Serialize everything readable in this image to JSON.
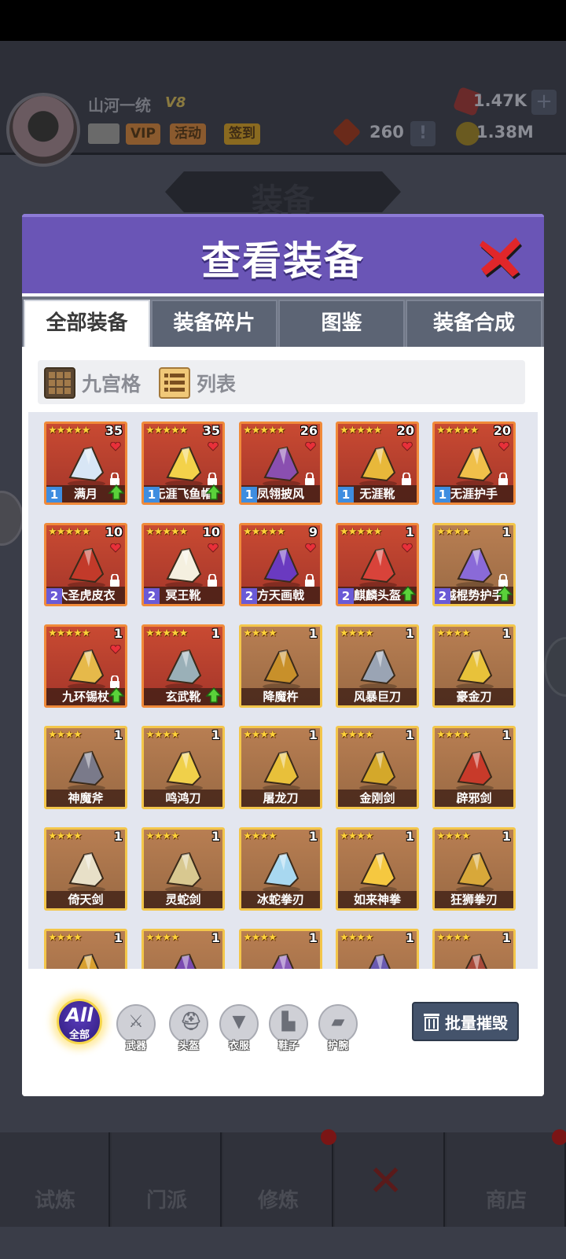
{
  "player": {
    "name": "山河一统",
    "vip_level": "V8",
    "chips": [
      "VIP",
      "活动",
      "签到"
    ],
    "gems": "1.47K",
    "tokens": "260",
    "gold": "1.38M"
  },
  "background_title": "装备",
  "bottom_nav": [
    "试炼",
    "门派",
    "修炼",
    "",
    "商店"
  ],
  "modal": {
    "title": "查看装备",
    "tabs": [
      "全部装备",
      "装备碎片",
      "图鉴",
      "装备合成"
    ],
    "active_tab": 0,
    "view_options": [
      "九宫格",
      "列表"
    ],
    "items": [
      {
        "name": "满月",
        "stars": 5,
        "count": "35",
        "level": "1",
        "rarity": "red",
        "heart": true,
        "lock": true,
        "upgrade": true,
        "icon": "moon-armor-icon"
      },
      {
        "name": "无涯飞鱼帽",
        "stars": 5,
        "count": "35",
        "level": "1",
        "rarity": "red",
        "heart": true,
        "lock": true,
        "upgrade": true,
        "icon": "gold-helmet-icon"
      },
      {
        "name": "凤翎披风",
        "stars": 5,
        "count": "26",
        "level": "1",
        "rarity": "red",
        "heart": true,
        "lock": true,
        "upgrade": false,
        "icon": "cloak-icon"
      },
      {
        "name": "无涯靴",
        "stars": 5,
        "count": "20",
        "level": "1",
        "rarity": "red",
        "heart": true,
        "lock": true,
        "upgrade": false,
        "icon": "boot-icon"
      },
      {
        "name": "无涯护手",
        "stars": 5,
        "count": "20",
        "level": "1",
        "rarity": "red",
        "heart": true,
        "lock": true,
        "upgrade": false,
        "icon": "bracer-icon"
      },
      {
        "name": "大圣虎皮衣",
        "stars": 5,
        "count": "10",
        "level": "2",
        "rarity": "red",
        "heart": true,
        "lock": true,
        "upgrade": false,
        "icon": "tiger-armor-icon"
      },
      {
        "name": "冥王靴",
        "stars": 5,
        "count": "10",
        "level": "2",
        "rarity": "red",
        "heart": true,
        "lock": true,
        "upgrade": false,
        "icon": "white-boot-icon"
      },
      {
        "name": "方天画戟",
        "stars": 5,
        "count": "9",
        "level": "2",
        "rarity": "red",
        "heart": true,
        "lock": true,
        "upgrade": false,
        "icon": "halberd-icon"
      },
      {
        "name": "麒麟头盔",
        "stars": 5,
        "count": "1",
        "level": "2",
        "rarity": "red",
        "heart": true,
        "lock": false,
        "upgrade": true,
        "icon": "qilin-helmet-icon"
      },
      {
        "name": "越棍势护手",
        "stars": 4,
        "count": "1",
        "level": "2",
        "rarity": "gold",
        "heart": false,
        "lock": true,
        "upgrade": true,
        "icon": "purple-bracer-icon"
      },
      {
        "name": "九环锡杖",
        "stars": 5,
        "count": "1",
        "level": "",
        "rarity": "red",
        "heart": true,
        "lock": true,
        "upgrade": true,
        "icon": "staff-icon"
      },
      {
        "name": "玄武靴",
        "stars": 5,
        "count": "1",
        "level": "",
        "rarity": "red",
        "heart": false,
        "lock": false,
        "upgrade": true,
        "icon": "xuanwu-boot-icon"
      },
      {
        "name": "降魔杵",
        "stars": 4,
        "count": "1",
        "level": "",
        "rarity": "gold",
        "heart": false,
        "lock": false,
        "upgrade": false,
        "icon": "pestle-icon"
      },
      {
        "name": "风暴巨刀",
        "stars": 4,
        "count": "1",
        "level": "",
        "rarity": "gold",
        "heart": false,
        "lock": false,
        "upgrade": false,
        "icon": "great-blade-icon"
      },
      {
        "name": "豪金刀",
        "stars": 4,
        "count": "1",
        "level": "",
        "rarity": "gold",
        "heart": false,
        "lock": false,
        "upgrade": false,
        "icon": "gold-blade-icon"
      },
      {
        "name": "神魔斧",
        "stars": 4,
        "count": "1",
        "level": "",
        "rarity": "gold",
        "heart": false,
        "lock": false,
        "upgrade": false,
        "icon": "axe-icon"
      },
      {
        "name": "鸣鸿刀",
        "stars": 4,
        "count": "1",
        "level": "",
        "rarity": "gold",
        "heart": false,
        "lock": false,
        "upgrade": false,
        "icon": "saber-icon"
      },
      {
        "name": "屠龙刀",
        "stars": 4,
        "count": "1",
        "level": "",
        "rarity": "gold",
        "heart": false,
        "lock": false,
        "upgrade": false,
        "icon": "dragon-saber-icon"
      },
      {
        "name": "金刚剑",
        "stars": 4,
        "count": "1",
        "level": "",
        "rarity": "gold",
        "heart": false,
        "lock": false,
        "upgrade": false,
        "icon": "gold-sword-icon"
      },
      {
        "name": "辟邪剑",
        "stars": 4,
        "count": "1",
        "level": "",
        "rarity": "gold",
        "heart": false,
        "lock": false,
        "upgrade": false,
        "icon": "red-sword-icon"
      },
      {
        "name": "倚天剑",
        "stars": 4,
        "count": "1",
        "level": "",
        "rarity": "gold",
        "heart": false,
        "lock": false,
        "upgrade": false,
        "icon": "sword-icon"
      },
      {
        "name": "灵蛇剑",
        "stars": 4,
        "count": "1",
        "level": "",
        "rarity": "gold",
        "heart": false,
        "lock": false,
        "upgrade": false,
        "icon": "snake-sword-icon"
      },
      {
        "name": "冰蛇拳刃",
        "stars": 4,
        "count": "1",
        "level": "",
        "rarity": "gold",
        "heart": false,
        "lock": false,
        "upgrade": false,
        "icon": "ice-claw-icon"
      },
      {
        "name": "如来神拳",
        "stars": 4,
        "count": "1",
        "level": "",
        "rarity": "gold",
        "heart": false,
        "lock": false,
        "upgrade": false,
        "icon": "fist-icon"
      },
      {
        "name": "狂狮拳刃",
        "stars": 4,
        "count": "1",
        "level": "",
        "rarity": "gold",
        "heart": false,
        "lock": false,
        "upgrade": false,
        "icon": "lion-claw-icon"
      },
      {
        "name": "",
        "stars": 4,
        "count": "1",
        "level": "",
        "rarity": "gold",
        "heart": false,
        "lock": false,
        "upgrade": false,
        "icon": "armor-icon"
      },
      {
        "name": "",
        "stars": 4,
        "count": "1",
        "level": "",
        "rarity": "gold",
        "heart": false,
        "lock": false,
        "upgrade": false,
        "icon": "hat-icon"
      },
      {
        "name": "",
        "stars": 4,
        "count": "1",
        "level": "",
        "rarity": "gold",
        "heart": false,
        "lock": false,
        "upgrade": false,
        "icon": "robe-icon"
      },
      {
        "name": "",
        "stars": 4,
        "count": "1",
        "level": "",
        "rarity": "gold",
        "heart": false,
        "lock": false,
        "upgrade": false,
        "icon": "helmet-icon"
      },
      {
        "name": "",
        "stars": 4,
        "count": "1",
        "level": "",
        "rarity": "gold",
        "heart": false,
        "lock": false,
        "upgrade": false,
        "icon": "bow-icon"
      }
    ],
    "filters": {
      "all_label": "All",
      "all_sub": "全部",
      "categories": [
        "武器",
        "头盔",
        "衣服",
        "鞋子",
        "护腕"
      ]
    },
    "bulk_button": "批量摧毁"
  },
  "colors": {
    "header": "#6a55b6",
    "red_frame": "#f08a3a",
    "gold_frame": "#f3c64a",
    "bulk_button": "#44536b"
  }
}
